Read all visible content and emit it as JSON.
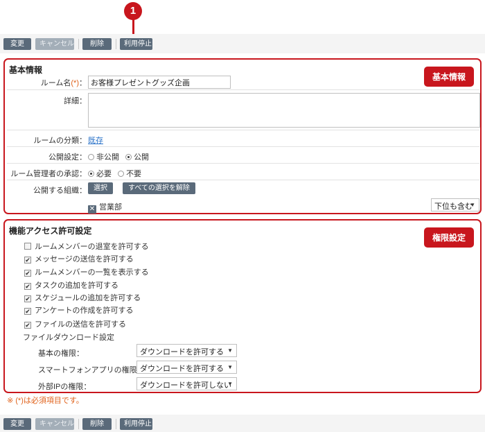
{
  "callout": {
    "number": "1"
  },
  "toolbar": {
    "change": "変更",
    "cancel": "キャンセル",
    "delete": "削除",
    "suspend": "利用停止"
  },
  "basic": {
    "title": "基本情報",
    "badge": "基本情報",
    "room_name_label": "ルーム名",
    "required_mark": "(*)",
    "colon": "：",
    "room_name_value": "お客様プレゼントグッズ企画",
    "detail_label": "詳細：",
    "category_label": "ルームの分類：",
    "category_value": "既存",
    "publish_label": "公開設定：",
    "publish_private": "非公開",
    "publish_public": "公開",
    "approval_label": "ルーム管理者の承認：",
    "approval_required": "必要",
    "approval_not_required": "不要",
    "org_label": "公開する組織：",
    "select_btn": "選択",
    "clear_all_btn": "すべての選択を解除",
    "org_item": "営業部",
    "sub_select": "下位も含む"
  },
  "perm": {
    "title": "機能アクセス許可設定",
    "badge": "権限設定",
    "options": [
      {
        "label": "ルームメンバーの退室を許可する",
        "checked": false
      },
      {
        "label": "メッセージの送信を許可する",
        "checked": true
      },
      {
        "label": "ルームメンバーの一覧を表示する",
        "checked": true
      },
      {
        "label": "タスクの追加を許可する",
        "checked": true
      },
      {
        "label": "スケジュールの追加を許可する",
        "checked": true
      },
      {
        "label": "アンケートの作成を許可する",
        "checked": true
      },
      {
        "label": "ファイルの送信を許可する",
        "checked": true
      }
    ],
    "download_heading": "ファイルダウンロード設定",
    "dl_basic_label": "基本の権限：",
    "dl_basic_value": "ダウンロードを許可する",
    "dl_smartphone_label": "スマートフォンアプリの権限：",
    "dl_smartphone_value": "ダウンロードを許可する",
    "dl_external_label": "外部IPの権限：",
    "dl_external_value": "ダウンロードを許可しない"
  },
  "note": "※ (*)は必須項目です。",
  "icons": {
    "check": "checkmark-icon",
    "remove": "x-icon",
    "dropdown": "chevron-down-icon"
  },
  "colors": {
    "accent": "#c8161d",
    "button": "#5a6a7a",
    "link": "#2a72c8",
    "required": "#e0621b"
  }
}
